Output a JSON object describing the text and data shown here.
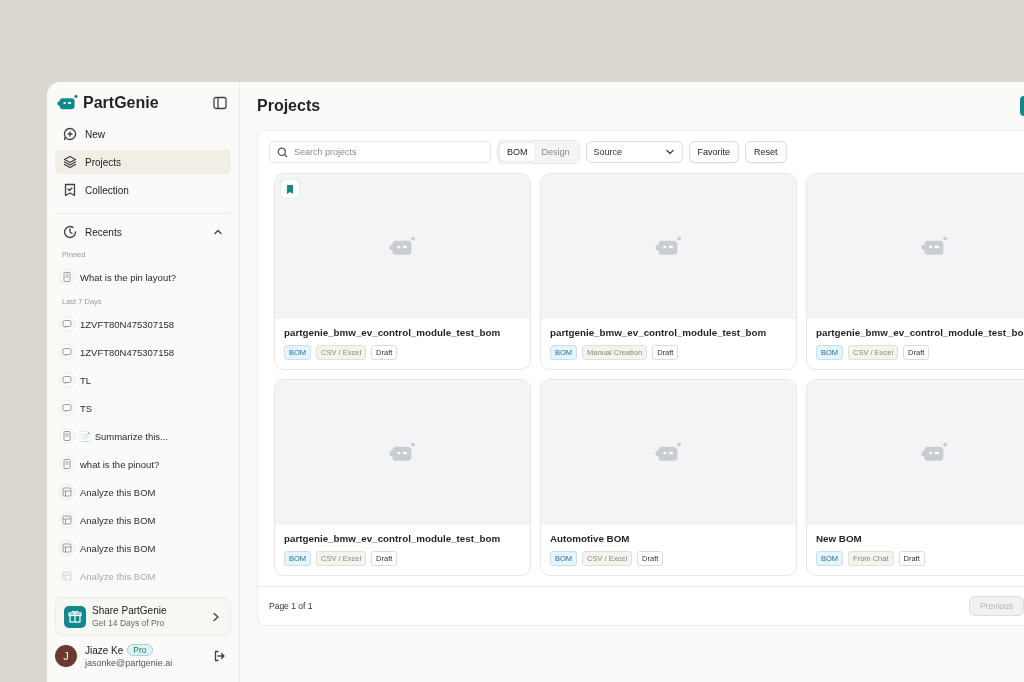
{
  "app": {
    "name": "PartGenie"
  },
  "sidebar": {
    "nav": [
      {
        "label": "New",
        "kind": "new",
        "selected": false
      },
      {
        "label": "Projects",
        "kind": "projects",
        "selected": true
      },
      {
        "label": "Collection",
        "kind": "collection",
        "selected": false
      }
    ],
    "recents": {
      "label": "Recents",
      "expanded": true,
      "groups": [
        {
          "heading": "Pinned",
          "items": [
            {
              "label": "What is the pin layout?",
              "kind": "doc"
            }
          ]
        },
        {
          "heading": "Last 7 Days",
          "items": [
            {
              "label": "1ZVFT80N475307158",
              "kind": "chat"
            },
            {
              "label": "1ZVFT80N475307158",
              "kind": "chat"
            },
            {
              "label": "TL",
              "kind": "chat"
            },
            {
              "label": "TS",
              "kind": "chat"
            },
            {
              "label": "📄 Summarize this...",
              "kind": "doc"
            },
            {
              "label": "what is the pinout?",
              "kind": "doc"
            },
            {
              "label": "Analyze this BOM",
              "kind": "table"
            },
            {
              "label": "Analyze this BOM",
              "kind": "table"
            },
            {
              "label": "Analyze this BOM",
              "kind": "table"
            },
            {
              "label": "Analyze this BOM",
              "kind": "table"
            }
          ]
        }
      ]
    },
    "share": {
      "title": "Share PartGenie",
      "subtitle": "Get 14 Days of Pro"
    },
    "user": {
      "initial": "J",
      "name": "Jiaze Ke",
      "badge": "Pro",
      "email": "jasonke@partgenie.ai"
    }
  },
  "main": {
    "title": "Projects",
    "search": {
      "placeholder": "Search projects"
    },
    "segments": [
      {
        "label": "BOM",
        "selected": true
      },
      {
        "label": "Design",
        "selected": false
      }
    ],
    "source": {
      "value": "Source"
    },
    "buttons": [
      "Favorite",
      "Reset"
    ],
    "projects": [
      {
        "title": "partgenie_bmw_ev_control_module_test_bom",
        "favorite": true,
        "tags": [
          {
            "label": "BOM",
            "kind": "type"
          },
          {
            "label": "CSV / Excel",
            "kind": "source"
          },
          {
            "label": "Draft",
            "kind": "status"
          }
        ]
      },
      {
        "title": "partgenie_bmw_ev_control_module_test_bom",
        "favorite": false,
        "tags": [
          {
            "label": "BOM",
            "kind": "type"
          },
          {
            "label": "Manual Creation",
            "kind": "source"
          },
          {
            "label": "Draft",
            "kind": "status"
          }
        ]
      },
      {
        "title": "partgenie_bmw_ev_control_module_test_bo",
        "favorite": false,
        "tags": [
          {
            "label": "BOM",
            "kind": "type"
          },
          {
            "label": "CSV / Excel",
            "kind": "source"
          },
          {
            "label": "Draft",
            "kind": "status"
          }
        ]
      },
      {
        "title": "partgenie_bmw_ev_control_module_test_bom",
        "favorite": false,
        "tags": [
          {
            "label": "BOM",
            "kind": "type"
          },
          {
            "label": "CSV / Excel",
            "kind": "source"
          },
          {
            "label": "Draft",
            "kind": "status"
          }
        ]
      },
      {
        "title": "Automotive BOM",
        "favorite": false,
        "tags": [
          {
            "label": "BOM",
            "kind": "type"
          },
          {
            "label": "CSV / Excel",
            "kind": "source"
          },
          {
            "label": "Draft",
            "kind": "status"
          }
        ]
      },
      {
        "title": "New BOM",
        "favorite": false,
        "tags": [
          {
            "label": "BOM",
            "kind": "type"
          },
          {
            "label": "From Chat",
            "kind": "source"
          },
          {
            "label": "Draft",
            "kind": "status"
          }
        ]
      }
    ],
    "pagination": {
      "text": "Page 1 of 1",
      "previous": {
        "label": "Previous",
        "disabled": true
      }
    }
  }
}
